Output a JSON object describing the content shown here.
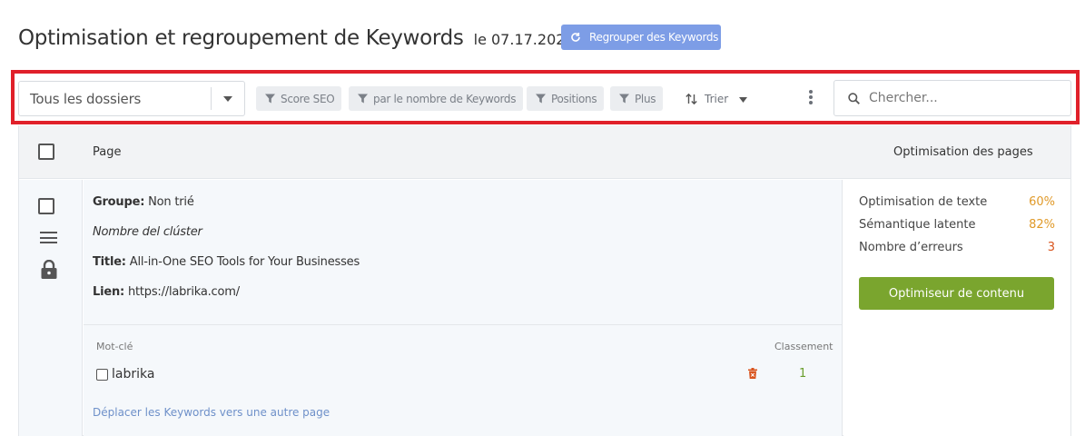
{
  "header": {
    "title": "Optimisation et regroupement de Keywords",
    "date": "le 07.17.2025",
    "regroup_button": "Regrouper des Keywords"
  },
  "toolbar": {
    "folder_select": "Tous les dossiers",
    "filters": [
      "Score SEO",
      "par le nombre de Keywords",
      "Positions",
      "Plus"
    ],
    "sort_label": "Trier",
    "search_placeholder": "Chercher..."
  },
  "table": {
    "col_page": "Page",
    "col_optimisation": "Optimisation des pages",
    "row": {
      "group_label": "Groupe:",
      "group_value": "Non trié",
      "cluster_name": "Nombre del clúster",
      "title_label": "Title:",
      "title_value": "All-in-One SEO Tools for Your Businesses",
      "link_label": "Lien:",
      "link_value": "https://labrika.com/",
      "kw_header": "Mot-clé",
      "rank_header": "Classement",
      "keyword": "labrika",
      "keyword_rank": "1",
      "move_link": "Déplacer les Keywords vers une autre page",
      "metrics": [
        {
          "label": "Optimisation de texte",
          "value": "60%"
        },
        {
          "label": "Sémantique latente",
          "value": "82%"
        },
        {
          "label": "Nombre d’erreurs",
          "value": "3"
        }
      ],
      "optimizer_button": "Optimiseur de contenu"
    }
  },
  "colors": {
    "highlight_border": "#e0202a",
    "primary_button": "#7d9de6",
    "green_button": "#7aa52e",
    "orange_value": "#e09a2a",
    "red_value": "#d9541e"
  }
}
